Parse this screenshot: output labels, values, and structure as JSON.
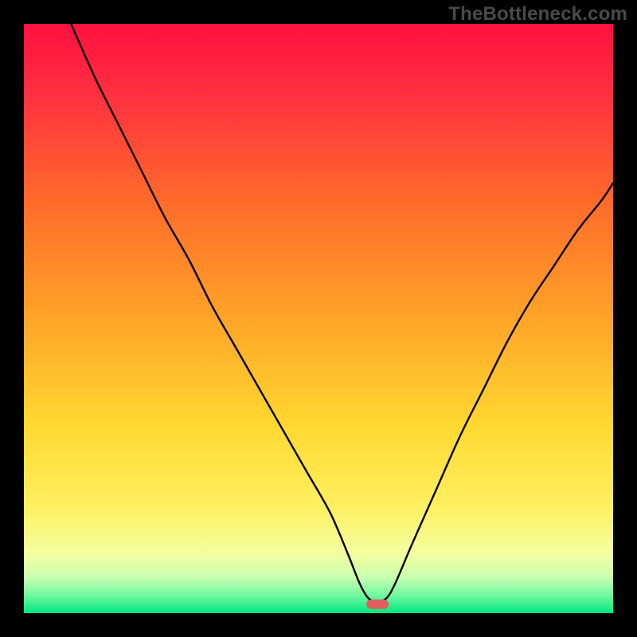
{
  "watermark": "TheBottleneck.com",
  "chart_data": {
    "type": "line",
    "title": "",
    "xlabel": "",
    "ylabel": "",
    "xlim": [
      0,
      100
    ],
    "ylim": [
      0,
      100
    ],
    "grid": false,
    "legend": false,
    "series": [
      {
        "name": "curve",
        "x": [
          8,
          12,
          16,
          20,
          24,
          28,
          32,
          36,
          40,
          44,
          48,
          52,
          55,
          57,
          58.5,
          60,
          61.5,
          63,
          66,
          70,
          74,
          78,
          82,
          86,
          90,
          94,
          98,
          100
        ],
        "y": [
          100,
          91,
          83,
          75,
          67,
          60,
          52,
          45,
          38,
          31,
          24,
          17,
          10,
          5,
          2.5,
          2,
          2.5,
          5,
          12,
          21,
          30,
          38,
          46,
          53,
          59,
          65,
          70,
          73
        ]
      }
    ],
    "marker": {
      "x": 60,
      "y": 1.5,
      "color": "#e06060"
    },
    "background_gradient": {
      "stops": [
        {
          "offset": 0.0,
          "color": "#ff1040"
        },
        {
          "offset": 0.12,
          "color": "#ff3040"
        },
        {
          "offset": 0.3,
          "color": "#ff6a2a"
        },
        {
          "offset": 0.5,
          "color": "#ffa428"
        },
        {
          "offset": 0.68,
          "color": "#ffd830"
        },
        {
          "offset": 0.82,
          "color": "#fff060"
        },
        {
          "offset": 0.9,
          "color": "#f2ffa0"
        },
        {
          "offset": 0.94,
          "color": "#c8ffb0"
        },
        {
          "offset": 0.97,
          "color": "#70f8a0"
        },
        {
          "offset": 1.0,
          "color": "#00e880"
        }
      ]
    }
  }
}
